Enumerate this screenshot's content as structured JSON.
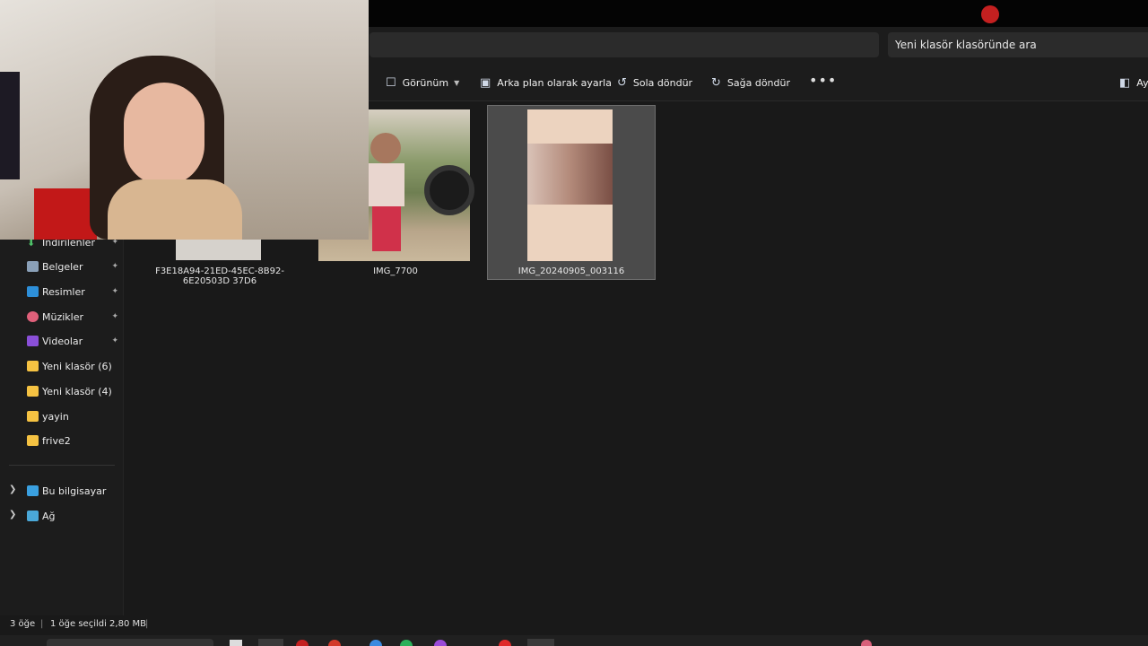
{
  "search": {
    "placeholder": "Yeni klasör klasöründe ara"
  },
  "toolbar": {
    "view_label": "Görünüm",
    "set_background_label": "Arka plan olarak ayarla",
    "rotate_left_label": "Sola döndür",
    "rotate_right_label": "Sağa döndür",
    "more_label": "•••",
    "details_label": "Ay"
  },
  "sidebar": {
    "quick_access": [
      {
        "label": "İndirilenler",
        "icon": "download-icon",
        "pinned": true
      },
      {
        "label": "Belgeler",
        "icon": "documents-icon",
        "pinned": true
      },
      {
        "label": "Resimler",
        "icon": "pictures-icon",
        "pinned": true
      },
      {
        "label": "Müzikler",
        "icon": "music-icon",
        "pinned": true
      },
      {
        "label": "Videolar",
        "icon": "videos-icon",
        "pinned": true
      },
      {
        "label": "Yeni klasör (6)",
        "icon": "folder-icon"
      },
      {
        "label": "Yeni klasör (4)",
        "icon": "folder-icon"
      },
      {
        "label": "yayin",
        "icon": "folder-icon"
      },
      {
        "label": "frive2",
        "icon": "folder-icon"
      }
    ],
    "locations": [
      {
        "label": "Bu bilgisayar",
        "icon": "computer-icon"
      },
      {
        "label": "Ağ",
        "icon": "network-icon"
      }
    ]
  },
  "files": [
    {
      "name": "F3E18A94-21ED-45EC-8B92-6E20503D 37D6",
      "selected": false
    },
    {
      "name": "IMG_7700",
      "selected": false
    },
    {
      "name": "IMG_20240905_003116",
      "selected": true
    }
  ],
  "status": {
    "item_count": "3 öğe",
    "selection": "1 öğe seçildi  2,80 MB"
  },
  "colors": {
    "background": "#191919",
    "folder": "#f5c242",
    "selection": "#4b4b4b"
  }
}
